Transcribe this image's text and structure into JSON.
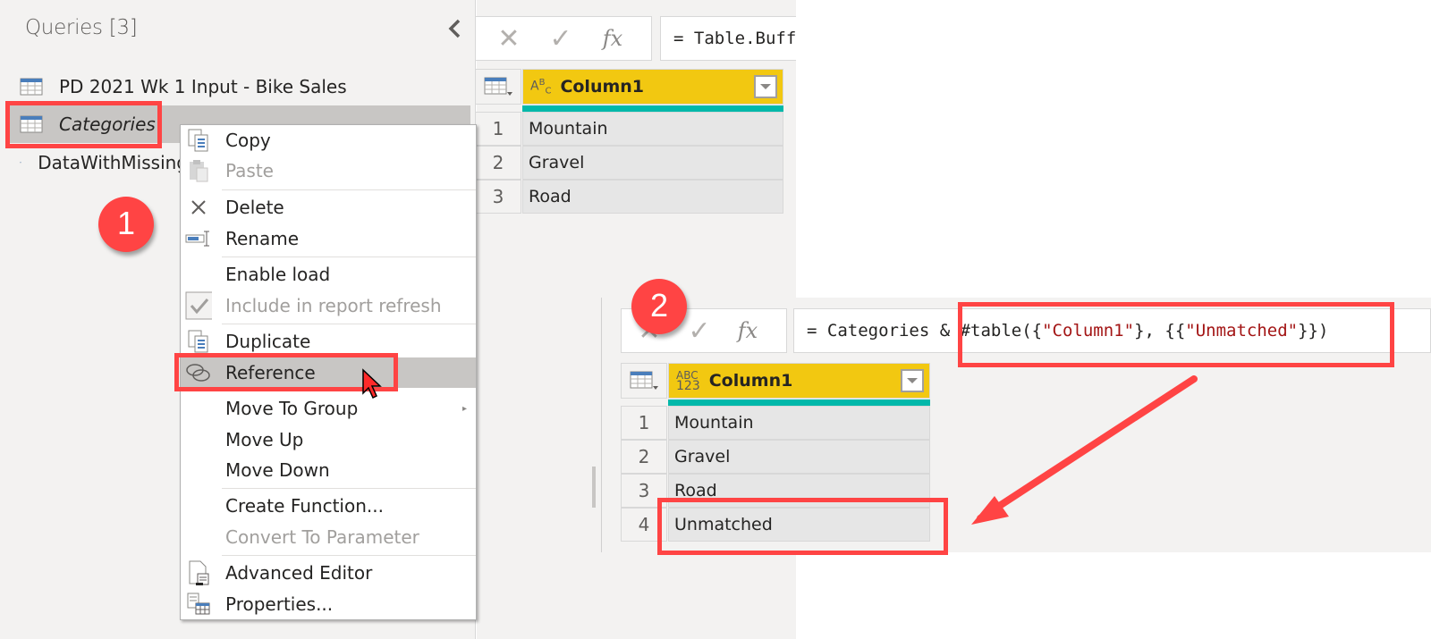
{
  "queries_pane": {
    "title": "Queries [3]",
    "collapse_icon": "chevron-left-icon",
    "items": [
      {
        "label": "PD 2021 Wk 1 Input - Bike Sales",
        "icon": "table-icon",
        "selected": false
      },
      {
        "label": "Categories",
        "icon": "table-icon",
        "selected": true
      },
      {
        "label": "DataWithMissing",
        "icon": "table-icon",
        "selected": false
      }
    ]
  },
  "annotations": {
    "step1": "1",
    "step2": "2",
    "highlight_color": "#ff4444"
  },
  "context_menu": {
    "items": [
      {
        "label": "Copy",
        "icon": "copy-icon",
        "disabled": false
      },
      {
        "label": "Paste",
        "icon": "paste-icon",
        "disabled": true
      },
      {
        "label": "Delete",
        "icon": "delete-x-icon",
        "disabled": false
      },
      {
        "label": "Rename",
        "icon": "rename-icon",
        "disabled": false
      },
      {
        "label": "Enable load",
        "icon": "",
        "disabled": false
      },
      {
        "label": "Include in report refresh",
        "icon": "checkbox-checked-icon",
        "disabled": true
      },
      {
        "label": "Duplicate",
        "icon": "duplicate-icon",
        "disabled": false
      },
      {
        "label": "Reference",
        "icon": "reference-icon",
        "disabled": false,
        "hovered": true
      },
      {
        "label": "Move To Group",
        "icon": "",
        "disabled": false,
        "submenu": true
      },
      {
        "label": "Move Up",
        "icon": "",
        "disabled": false
      },
      {
        "label": "Move Down",
        "icon": "",
        "disabled": false
      },
      {
        "label": "Create Function...",
        "icon": "",
        "disabled": false
      },
      {
        "label": "Convert To Parameter",
        "icon": "",
        "disabled": true
      },
      {
        "label": "Advanced Editor",
        "icon": "advanced-editor-icon",
        "disabled": false
      },
      {
        "label": "Properties...",
        "icon": "properties-icon",
        "disabled": false
      }
    ]
  },
  "editor1": {
    "cancel_icon": "✕",
    "commit_icon": "✓",
    "fx_label": "fx",
    "formula": "= Table.Buff",
    "column": {
      "type_icon": "ABC",
      "label": "Column1"
    },
    "rows": [
      {
        "n": "1",
        "value": "Mountain"
      },
      {
        "n": "2",
        "value": "Gravel"
      },
      {
        "n": "3",
        "value": "Road"
      }
    ]
  },
  "editor2": {
    "cancel_icon": "✕",
    "commit_icon": "✓",
    "fx_label": "fx",
    "formula": {
      "prefix": "= Categories ",
      "p1": "& #table({",
      "s1": "\"Column1\"",
      "p2": "}, {{",
      "s2": "\"Unmatched\"",
      "p3": "}})"
    },
    "column": {
      "type_icon_top": "ABC",
      "type_icon_bottom": "123",
      "label": "Column1"
    },
    "rows": [
      {
        "n": "1",
        "value": "Mountain"
      },
      {
        "n": "2",
        "value": "Gravel"
      },
      {
        "n": "3",
        "value": "Road"
      },
      {
        "n": "4",
        "value": "Unmatched"
      }
    ]
  }
}
